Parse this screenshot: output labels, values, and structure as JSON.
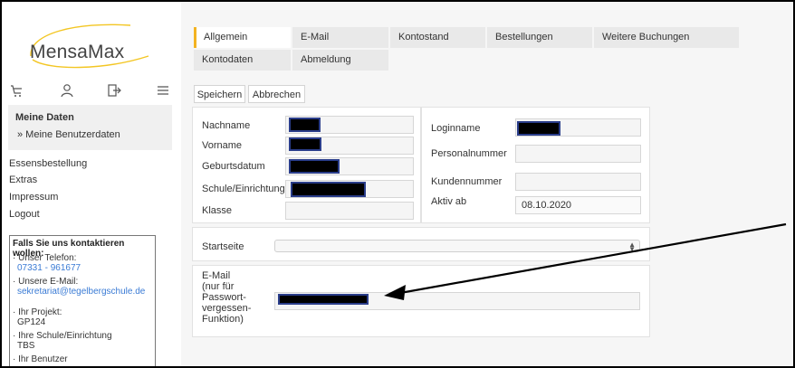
{
  "app": {
    "logo_text": "MensaMax"
  },
  "sidebar": {
    "section_title": "Meine Daten",
    "section_sub": "» Meine Benutzerdaten",
    "links": [
      "Essensbestellung",
      "Extras",
      "Impressum",
      "Logout"
    ],
    "contact": {
      "title": "Falls Sie uns kontaktieren wollen:",
      "phone_label": "· Unser Telefon:",
      "phone_value": "07331 - 961677",
      "email_label": "· Unsere E-Mail:",
      "email_value": "sekretariat@tegelbergschule.de",
      "project_label": "· Ihr Projekt:",
      "project_value": "GP124",
      "school_label": "· Ihre Schule/Einrichtung",
      "school_value": "TBS",
      "more_label": "· Ihr Benutzer"
    }
  },
  "tabs": {
    "row1": [
      "Allgemein",
      "E-Mail",
      "Kontostand",
      "Bestellungen",
      "Weitere Buchungen"
    ],
    "row2": [
      "Kontodaten",
      "Abmeldung"
    ]
  },
  "actions": {
    "save": "Speichern",
    "cancel": "Abbrechen"
  },
  "personal": {
    "fields": [
      "Nachname",
      "Vorname",
      "Geburtsdatum",
      "Schule/Einrichtung",
      "Klasse"
    ]
  },
  "login": {
    "fields": [
      "Loginname",
      "Personalnummer",
      "Kundennummer",
      "Aktiv ab"
    ],
    "aktiv_ab_value": "08.10.2020"
  },
  "startseite": {
    "label": "Startseite"
  },
  "email_section": {
    "label": "E-Mail\n(nur für\nPasswort-\nvergessen-\nFunktion)"
  },
  "colors": {
    "accent": "#f3b321",
    "link": "#3a7bd5",
    "redaction_border": "#2a3d8a"
  }
}
